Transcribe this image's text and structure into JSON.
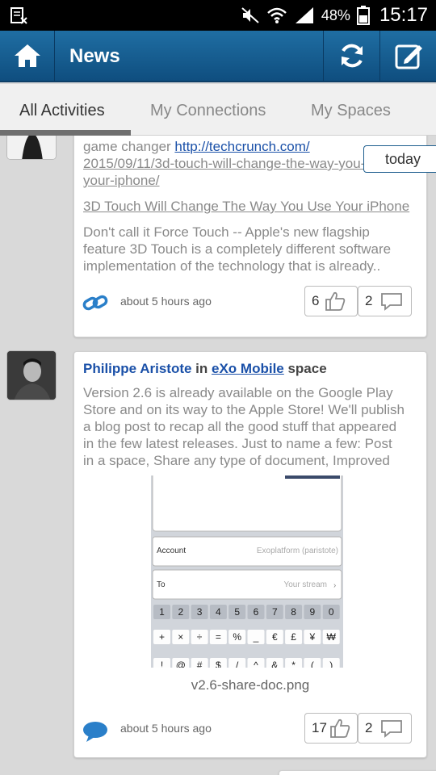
{
  "status_bar": {
    "battery": "48%",
    "time": "15:17"
  },
  "header": {
    "title": "News"
  },
  "tabs": [
    "All Activities",
    "My Connections",
    "My Spaces"
  ],
  "date_badge": "today",
  "activity1": {
    "text_prefix": "game changer ",
    "url_line1": "http://techcrunch.com/",
    "url_line2": "2015/09/11/3d-touch-will-change-the-way-you-use-",
    "url_line3": "your-iphone/",
    "link_title": "3D Touch Will Change The Way You Use Your iPhone",
    "summary_line1": "Don't call it Force Touch -- Apple's new flagship",
    "summary_line2": "feature 3D Touch is a completely different software",
    "summary_line3": "implementation of the technology that is already..",
    "time": "about 5 hours ago",
    "likes": "6",
    "comments": "2"
  },
  "activity2": {
    "author": "Philippe Aristote",
    "in_word": " in ",
    "space": "eXo Mobile",
    "space_word": " space",
    "body_line1": "Version 2.6 is already available on the Google Play",
    "body_line2": "Store and on its way to the Apple Store! We'll publish",
    "body_line3": "a blog post to recap all the good stuff that appeared",
    "body_line4": "in the few latest releases. Just to name a few: Post",
    "body_line5": "in a space, Share any type of document, Improved",
    "attachment": {
      "account_label": "Account",
      "account_value": "Exoplatform (paristote)",
      "to_label": "To",
      "to_value": "Your stream",
      "keys_row1": [
        "1",
        "2",
        "3",
        "4",
        "5",
        "6",
        "7",
        "8",
        "9",
        "0"
      ],
      "keys_row2": [
        "+",
        "×",
        "÷",
        "=",
        "%",
        "_",
        "€",
        "£",
        "¥",
        "₩"
      ],
      "keys_row3": [
        "!",
        "@",
        "#",
        "$",
        "/",
        "^",
        "&",
        "*",
        "(",
        ")"
      ]
    },
    "file_name": "v2.6-share-doc.png",
    "time": "about 5 hours ago",
    "likes": "17",
    "comments": "2"
  },
  "colors": {
    "app_bar": "#1a5f92",
    "link": "#1a50a8"
  }
}
